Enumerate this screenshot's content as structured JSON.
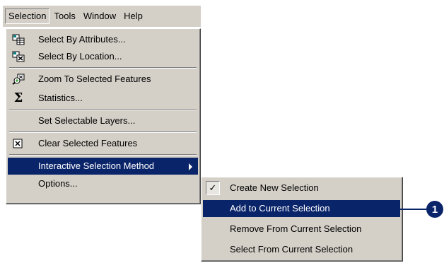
{
  "menubar": {
    "items": [
      "Selection",
      "Tools",
      "Window",
      "Help"
    ]
  },
  "selection_menu": {
    "items": [
      {
        "label": "Select By Attributes...",
        "icon": "select-by-attributes-icon"
      },
      {
        "label": "Select By Location...",
        "icon": "select-by-location-icon"
      },
      {
        "label": "Zoom To Selected Features",
        "icon": "zoom-to-selected-icon"
      },
      {
        "label": "Statistics...",
        "icon": "sigma-icon",
        "glyph": "Σ"
      },
      {
        "label": "Set Selectable Layers..."
      },
      {
        "label": "Clear Selected Features",
        "icon": "clear-selection-icon"
      },
      {
        "label": "Interactive Selection Method",
        "highlighted": true,
        "has_submenu": true
      },
      {
        "label": "Options..."
      }
    ]
  },
  "submenu": {
    "items": [
      {
        "label": "Create New Selection",
        "checked": true,
        "check_glyph": "✓"
      },
      {
        "label": "Add to Current Selection",
        "highlighted": true
      },
      {
        "label": "Remove From Current Selection"
      },
      {
        "label": "Select From Current Selection"
      }
    ]
  },
  "callout": {
    "number": "1",
    "color": "#0a246a"
  },
  "colors": {
    "menu_bg": "#d4d0c8",
    "highlight": "#0a246a",
    "highlight_text": "#ffffff"
  }
}
